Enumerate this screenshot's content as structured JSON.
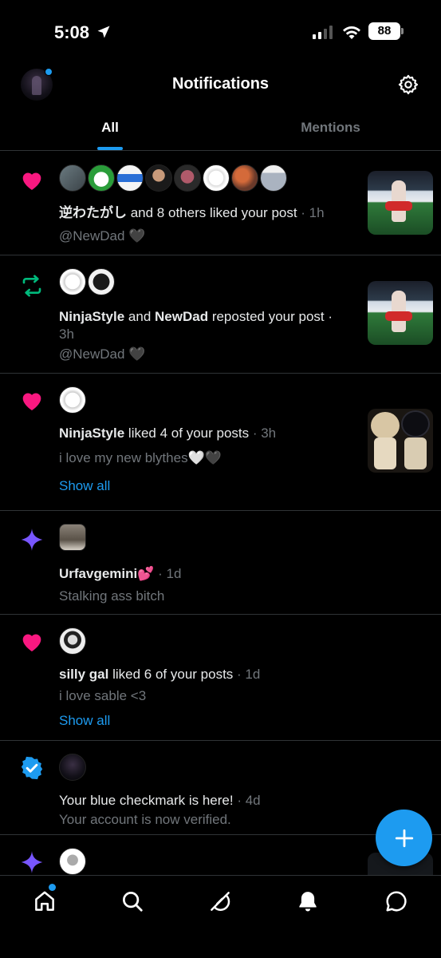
{
  "status_bar": {
    "time": "5:08",
    "battery": "88"
  },
  "header": {
    "title": "Notifications"
  },
  "tabs": [
    {
      "label": "All"
    },
    {
      "label": "Mentions"
    }
  ],
  "notifications": [
    {
      "type": "like",
      "actor": "逆わたがし",
      "text": " and 8 others liked your post",
      "time": " · 1h",
      "sub": "@NewDad 🖤"
    },
    {
      "type": "repost",
      "actor": "NinjaStyle",
      "joiner": " and ",
      "actor2": "NewDad",
      "text": " reposted your post ·",
      "time": "3h",
      "sub": "@NewDad 🖤"
    },
    {
      "type": "like",
      "actor": "NinjaStyle",
      "text": " liked 4 of your posts",
      "time": " · 3h",
      "sub": "i love my new blythes🤍🖤",
      "show_all": "Show all"
    },
    {
      "type": "recommendation",
      "actor": "Urfavgemini💕",
      "time": " · 1d",
      "sub": "Stalking ass bitch"
    },
    {
      "type": "like",
      "actor": "silly gal",
      "text": " liked 6 of your posts",
      "time": " · 1d",
      "sub": "i love sable <3",
      "show_all": "Show all"
    },
    {
      "type": "verified",
      "text": "Your blue checkmark is here!",
      "time": " · 4d",
      "sub": "Your account is now verified."
    },
    {
      "type": "recommendation"
    }
  ],
  "icons": {
    "like": "heart-icon",
    "repost": "repost-icon",
    "recommendation": "sparkle-icon",
    "verified": "verified-badge-icon",
    "nav": [
      "home-icon",
      "search-icon",
      "grok-icon",
      "notifications-icon",
      "messages-icon"
    ]
  },
  "colors": {
    "accent": "#1d9bf0",
    "like": "#f91880",
    "repost": "#00ba7c",
    "sparkle": "#7856ff",
    "muted": "#71767b"
  }
}
